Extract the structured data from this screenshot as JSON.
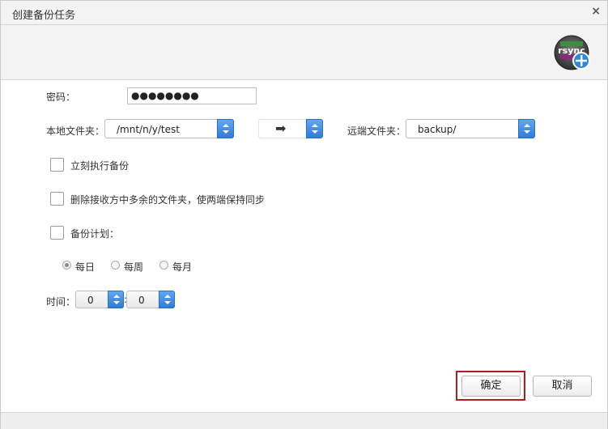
{
  "dialog": {
    "title": "创建备份任务",
    "close_glyph": "×",
    "logo_text": "rsync"
  },
  "form": {
    "password_label": "密码：",
    "password_value": "●●●●●●●●",
    "local_folder_label": "本地文件夹：",
    "local_folder_value": "/mnt/n/y/test",
    "direction_glyph": "➡",
    "remote_folder_label": "远端文件夹：",
    "remote_folder_value": "backup/",
    "run_now_label": "立刻执行备份",
    "delete_extra_label": "删除接收方中多余的文件夹，使两端保持同步",
    "schedule_label": "备份计划：",
    "schedule_options": [
      {
        "label": "每日",
        "checked": true
      },
      {
        "label": "每周",
        "checked": false
      },
      {
        "label": "每月",
        "checked": false
      }
    ],
    "time_label": "时间：",
    "hour_value": "0",
    "minute_value": "0",
    "time_separator": ":"
  },
  "buttons": {
    "confirm_label": "确定",
    "cancel_label": "取消"
  },
  "colors": {
    "focus_ring": "#b11c1c",
    "spin_accent": "#2f7cd9"
  }
}
